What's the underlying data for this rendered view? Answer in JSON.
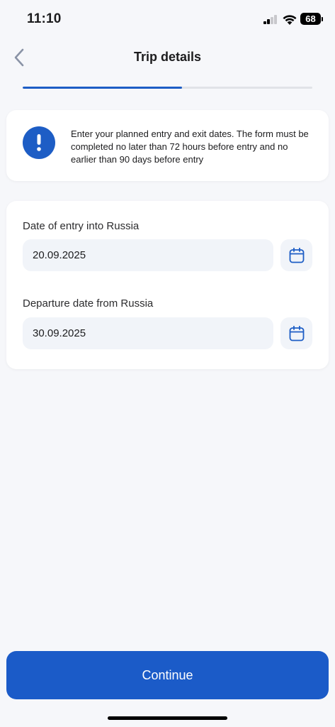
{
  "status_bar": {
    "time": "11:10",
    "battery": "68",
    "icons": [
      "signal-icon",
      "wifi-icon",
      "battery-icon"
    ]
  },
  "nav": {
    "title": "Trip details",
    "back_icon": "chevron-left-icon"
  },
  "progress": {
    "fraction": 0.55
  },
  "info": {
    "icon": "exclamation-icon",
    "text": "Enter your planned entry and exit dates. The form must be completed no later than 72 hours before entry and no earlier than 90 days before entry"
  },
  "form": {
    "entry": {
      "label": "Date of entry into Russia",
      "value": "20.09.2025",
      "icon": "calendar-icon"
    },
    "departure": {
      "label": "Departure date from Russia",
      "value": "30.09.2025",
      "icon": "calendar-icon"
    }
  },
  "actions": {
    "continue_label": "Continue"
  },
  "colors": {
    "accent": "#1D5DC5",
    "button": "#1B5BC8",
    "background": "#F6F7FA",
    "input_background": "#F1F4F9"
  }
}
